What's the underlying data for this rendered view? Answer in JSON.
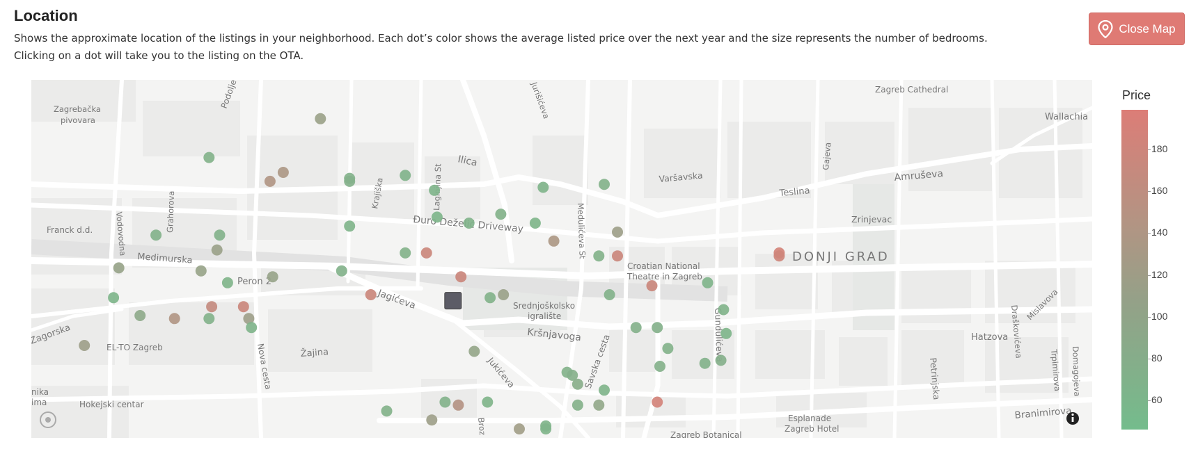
{
  "header": {
    "title": "Location",
    "description_line1": "Shows the approximate location of the listings in your neighborhood. Each dot’s color shows the average listed price over the next year and the size represents the number of bedrooms.",
    "description_line2": "Clicking on a dot will take you to the listing on the OTA.",
    "close_map_label": "Close Map"
  },
  "colors": {
    "accent": "#df7a74",
    "price_high": "#dc7d77",
    "price_mid": "#9ea08a",
    "price_low": "#74bc8c",
    "target": "#5c5c66"
  },
  "map": {
    "place_labels": [
      "Zagreb Cathedral",
      "Wallachia",
      "Zagrebačka",
      "pivovara",
      "Podolje",
      "Ilica",
      "Krajiška",
      "Laginjina St",
      "Varšavska",
      "Teslina",
      "Amruševa",
      "Gajeva",
      "Zrinjevac",
      "DONJI GRAD",
      "Franck d.d.",
      "Vodovodna",
      "Grahorova",
      "Medimurska",
      "Đuro Deželić Driveway",
      "Medulićeva St",
      "Croatian National",
      "Theatre in Zagreb",
      "Peron 2",
      "Jagićeva",
      "Srednjoškolsko",
      "igralište",
      "Kršnjavoga",
      "Savska cesta",
      "Gundulićeva",
      "Hatzova",
      "Draškovićeva",
      "Mislavova",
      "Trpimirova",
      "Domagojeva",
      "Petrinjska",
      "Zagorska",
      "EL-TO Zagreb",
      "Nova cesta",
      "Žajina",
      "Jukićeva",
      "Hokejski centar",
      "nika",
      "ima",
      "Esplanade",
      "Zagreb Hotel",
      "Branimirova",
      "Zagreb Botanical",
      "Broz",
      "Jurišićeva"
    ],
    "listings": [
      {
        "lng": 15.9644,
        "lat": 45.815,
        "price": 110
      },
      {
        "lng": 15.9602,
        "lat": 45.8137,
        "price": 70
      },
      {
        "lng": 15.963,
        "lat": 45.8132,
        "price": 135
      },
      {
        "lng": 15.9625,
        "lat": 45.8129,
        "price": 140
      },
      {
        "lng": 15.9655,
        "lat": 45.813,
        "price": 70
      },
      {
        "lng": 15.9655,
        "lat": 45.8129,
        "price": 72
      },
      {
        "lng": 15.9676,
        "lat": 45.8131,
        "price": 68
      },
      {
        "lng": 15.9687,
        "lat": 45.8126,
        "price": 66
      },
      {
        "lng": 15.9728,
        "lat": 45.8127,
        "price": 66
      },
      {
        "lng": 15.9751,
        "lat": 45.8128,
        "price": 70
      },
      {
        "lng": 15.9688,
        "lat": 45.8117,
        "price": 64
      },
      {
        "lng": 15.9655,
        "lat": 45.8114,
        "price": 66
      },
      {
        "lng": 15.9712,
        "lat": 45.8118,
        "price": 70
      },
      {
        "lng": 15.97,
        "lat": 45.8115,
        "price": 68
      },
      {
        "lng": 15.9725,
        "lat": 45.8115,
        "price": 64
      },
      {
        "lng": 15.9756,
        "lat": 45.8112,
        "price": 115
      },
      {
        "lng": 15.9732,
        "lat": 45.8109,
        "price": 135
      },
      {
        "lng": 15.9582,
        "lat": 45.8111,
        "price": 70
      },
      {
        "lng": 15.9606,
        "lat": 45.8111,
        "price": 70
      },
      {
        "lng": 15.9605,
        "lat": 45.8106,
        "price": 110
      },
      {
        "lng": 15.9676,
        "lat": 45.8105,
        "price": 70
      },
      {
        "lng": 15.9684,
        "lat": 45.8105,
        "price": 175
      },
      {
        "lng": 15.9749,
        "lat": 45.8104,
        "price": 70
      },
      {
        "lng": 15.9756,
        "lat": 45.8104,
        "price": 175
      },
      {
        "lng": 15.9817,
        "lat": 45.8105,
        "price": 185
      },
      {
        "lng": 15.9817,
        "lat": 45.8104,
        "price": 180
      },
      {
        "lng": 15.9568,
        "lat": 45.81,
        "price": 105
      },
      {
        "lng": 15.9599,
        "lat": 45.8099,
        "price": 105
      },
      {
        "lng": 15.9652,
        "lat": 45.8099,
        "price": 70
      },
      {
        "lng": 15.9626,
        "lat": 45.8097,
        "price": 105
      },
      {
        "lng": 15.9609,
        "lat": 45.8095,
        "price": 66
      },
      {
        "lng": 15.9697,
        "lat": 45.8097,
        "price": 175
      },
      {
        "lng": 15.9769,
        "lat": 45.8094,
        "price": 175
      },
      {
        "lng": 15.979,
        "lat": 45.8095,
        "price": 65
      },
      {
        "lng": 15.9753,
        "lat": 45.8091,
        "price": 70
      },
      {
        "lng": 15.9663,
        "lat": 45.8091,
        "price": 175
      },
      {
        "lng": 15.9708,
        "lat": 45.809,
        "price": 70
      },
      {
        "lng": 15.9713,
        "lat": 45.8091,
        "price": 110
      },
      {
        "lng": 15.9566,
        "lat": 45.809,
        "price": 64
      },
      {
        "lng": 15.9615,
        "lat": 45.8087,
        "price": 175
      },
      {
        "lng": 15.9603,
        "lat": 45.8087,
        "price": 165
      },
      {
        "lng": 15.9796,
        "lat": 45.8086,
        "price": 68
      },
      {
        "lng": 15.9576,
        "lat": 45.8084,
        "price": 90
      },
      {
        "lng": 15.9589,
        "lat": 45.8083,
        "price": 140
      },
      {
        "lng": 15.9602,
        "lat": 45.8083,
        "price": 70
      },
      {
        "lng": 15.9617,
        "lat": 45.8083,
        "price": 115
      },
      {
        "lng": 15.9618,
        "lat": 45.808,
        "price": 66
      },
      {
        "lng": 15.9763,
        "lat": 45.808,
        "price": 72
      },
      {
        "lng": 15.9771,
        "lat": 45.808,
        "price": 72
      },
      {
        "lng": 15.9797,
        "lat": 45.8078,
        "price": 64
      },
      {
        "lng": 15.9555,
        "lat": 45.8074,
        "price": 115
      },
      {
        "lng": 15.9702,
        "lat": 45.8072,
        "price": 100
      },
      {
        "lng": 15.9775,
        "lat": 45.8073,
        "price": 70
      },
      {
        "lng": 15.9795,
        "lat": 45.8069,
        "price": 75
      },
      {
        "lng": 15.9789,
        "lat": 45.8068,
        "price": 70
      },
      {
        "lng": 15.9772,
        "lat": 45.8067,
        "price": 72
      },
      {
        "lng": 15.9737,
        "lat": 45.8065,
        "price": 70
      },
      {
        "lng": 15.9739,
        "lat": 45.8064,
        "price": 75
      },
      {
        "lng": 15.9741,
        "lat": 45.8061,
        "price": 80
      },
      {
        "lng": 15.9751,
        "lat": 45.8059,
        "price": 66
      },
      {
        "lng": 15.9691,
        "lat": 45.8055,
        "price": 70
      },
      {
        "lng": 15.9696,
        "lat": 45.8054,
        "price": 145
      },
      {
        "lng": 15.9707,
        "lat": 45.8055,
        "price": 66
      },
      {
        "lng": 15.9741,
        "lat": 45.8054,
        "price": 72
      },
      {
        "lng": 15.9749,
        "lat": 45.8054,
        "price": 95
      },
      {
        "lng": 15.9771,
        "lat": 45.8055,
        "price": 185
      },
      {
        "lng": 15.9669,
        "lat": 45.8052,
        "price": 70
      },
      {
        "lng": 15.9686,
        "lat": 45.8049,
        "price": 115
      },
      {
        "lng": 15.9719,
        "lat": 45.8046,
        "price": 120
      },
      {
        "lng": 15.9729,
        "lat": 45.8047,
        "price": 66
      },
      {
        "lng": 15.9729,
        "lat": 45.8046,
        "price": 66
      }
    ],
    "target_marker": {
      "lng": 15.9694,
      "lat": 45.8089
    }
  },
  "legend": {
    "title": "Price",
    "ticks": [
      180,
      160,
      140,
      120,
      100,
      80,
      60
    ],
    "min": 46,
    "max": 199
  }
}
